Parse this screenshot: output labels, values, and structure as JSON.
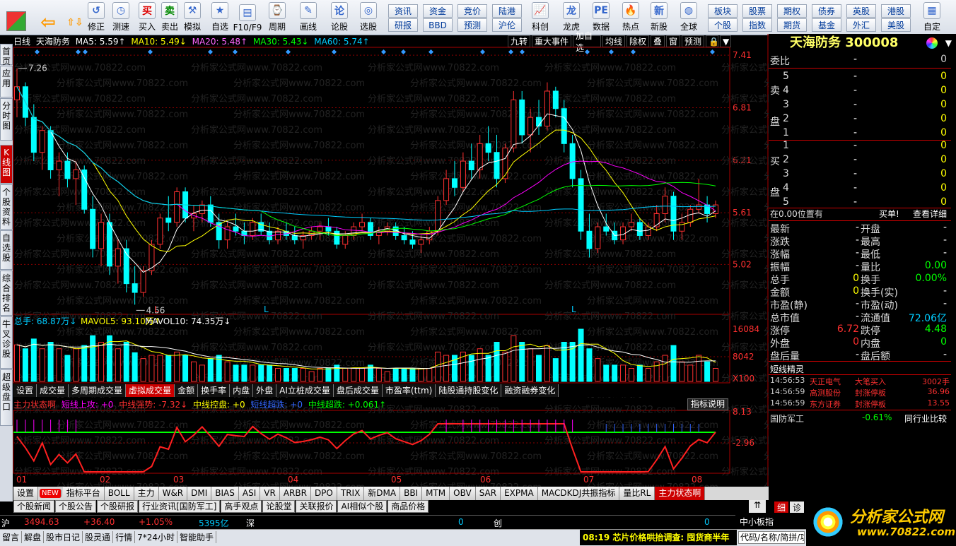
{
  "toolbar": {
    "buttons": [
      {
        "label": "后退",
        "icon": "back-arrow-icon"
      },
      {
        "label": "修正",
        "icon": "fix-icon"
      },
      {
        "label": "测速",
        "icon": "clock-icon"
      },
      {
        "label": "买入",
        "icon": "buy-icon",
        "glyph": "买"
      },
      {
        "label": "卖出",
        "icon": "sell-icon",
        "glyph": "卖"
      },
      {
        "label": "模拟",
        "icon": "hammer-icon"
      },
      {
        "label": "自选",
        "icon": "star-icon"
      },
      {
        "label": "F10/F9",
        "icon": "f10-icon"
      },
      {
        "label": "周期",
        "icon": "period-icon"
      },
      {
        "label": "画线",
        "icon": "pencil-icon"
      },
      {
        "label": "论股",
        "icon": "forum-icon"
      },
      {
        "label": "选股",
        "icon": "select-stock-icon"
      },
      {
        "label": "科创",
        "icon": "kechuang-icon"
      },
      {
        "label": "龙虎",
        "icon": "dragon-tiger-icon"
      },
      {
        "label": "数据",
        "icon": "data-icon"
      },
      {
        "label": "热点",
        "icon": "hot-icon"
      },
      {
        "label": "新股",
        "icon": "ipo-icon"
      },
      {
        "label": "全球",
        "icon": "globe-icon"
      },
      {
        "label": "自定",
        "icon": "custom-icon"
      }
    ],
    "grid_buttons": [
      "资讯",
      "资金",
      "竞价",
      "陆港",
      "研报",
      "BBD",
      "预测",
      "沪伦",
      "板块",
      "股票",
      "期权",
      "债券",
      "英股",
      "港股",
      "个股",
      "指数",
      "期货",
      "基金",
      "外汇",
      "美股"
    ]
  },
  "side_tabs": [
    "首页",
    "应用",
    "分时图",
    "K线图",
    "个股资料",
    "自选股",
    "综合排名",
    "牛叉诊股",
    "超级盘口"
  ],
  "chart_header": {
    "period": "日线",
    "stock": "天海防务",
    "ma5": "MA5: 5.59↑",
    "ma10": "MA10: 5.49↓",
    "ma20": "MA20: 5.48↑",
    "ma30": "MA30: 5.43↓",
    "ma60": "MA60: 5.74↑"
  },
  "chart_buttons": [
    "九转",
    "重大事件",
    "加自选",
    "均线",
    "除权",
    "叠",
    "窗",
    "预测"
  ],
  "price_axis": [
    "7.41",
    "6.81",
    "6.21",
    "5.61",
    "5.02"
  ],
  "annotations": {
    "high": "7.26",
    "low": "4.56",
    "markers": [
      "L",
      "L",
      "L"
    ]
  },
  "volume_header": {
    "total": "总手: 68.87万↓",
    "mavol5": "MAVOL5: 93.10万↑",
    "mavol10": "MAVOL10: 74.35万↓"
  },
  "volume_axis": [
    "16084",
    "8042",
    "X100"
  ],
  "mid_tabs": [
    "设置",
    "成交量",
    "多周期成交量",
    "虚拟成交量",
    "金额",
    "换手率",
    "内盘",
    "外盘",
    "AI立桩成交量",
    "盘后成交量",
    "市盈率(ttm)",
    "陆股通持股变化",
    "融资融券变化"
  ],
  "indicator_header": {
    "name": "主力状态啊",
    "t1": "短线上攻: +0",
    "t2": "中线强势: -7.32↓",
    "t3": "中线控盘: +0",
    "t4": "短线超跌: +0",
    "t5": "中线超跌: +0.061↑",
    "btn": "指标说明"
  },
  "indicator_axis": [
    "8.13",
    "-2.96"
  ],
  "x_axis": [
    "01",
    "02",
    "03",
    "04",
    "05",
    "06",
    "07",
    "08"
  ],
  "bottom_tabs": [
    "设置",
    "NEW",
    "指标平台",
    "BOLL",
    "主力",
    "W&R",
    "DMI",
    "BIAS",
    "ASI",
    "VR",
    "ARBR",
    "DPO",
    "TRIX",
    "新DMA",
    "BBI",
    "MTM",
    "OBV",
    "SAR",
    "EXPMA",
    "MACDKDJ共振指标",
    "量比RL",
    "主力状态啊"
  ],
  "sub_tabs": [
    "个股新闻",
    "个股公告",
    "个股研报",
    "行业资讯[国防军工]",
    "高手观点",
    "论股堂",
    "关联报价",
    "AI相似个股",
    "商品价格"
  ],
  "right": {
    "title": "天海防务 300008",
    "weibi": "委比",
    "weibi_v1": "-",
    "weibi_v2": "0",
    "sell_label": "卖盘",
    "buy_label": "买盘",
    "sells": [
      {
        "n": "5",
        "p": "-",
        "v": "0"
      },
      {
        "n": "4",
        "p": "-",
        "v": "0"
      },
      {
        "n": "3",
        "p": "-",
        "v": "0"
      },
      {
        "n": "2",
        "p": "-",
        "v": "0"
      },
      {
        "n": "1",
        "p": "-",
        "v": "0"
      }
    ],
    "buys": [
      {
        "n": "1",
        "p": "-",
        "v": "0"
      },
      {
        "n": "2",
        "p": "-",
        "v": "0"
      },
      {
        "n": "3",
        "p": "-",
        "v": "0"
      },
      {
        "n": "4",
        "p": "-",
        "v": "0"
      },
      {
        "n": "5",
        "p": "-",
        "v": "0"
      }
    ],
    "position": "在0.00位置有",
    "buy_single": "买单!",
    "detail": "查看详细",
    "stats": [
      [
        "最新",
        "-",
        "开盘",
        "-"
      ],
      [
        "涨跌",
        "-",
        "最高",
        "-"
      ],
      [
        "涨幅",
        "-",
        "最低",
        "-"
      ],
      [
        "振幅",
        "-",
        "量比",
        "0.00"
      ],
      [
        "总手",
        "0",
        "换手",
        "0.00%"
      ],
      [
        "金额",
        "0",
        "换手(实)",
        "-"
      ],
      [
        "市盈(静)",
        "-",
        "市盈(动)",
        "-"
      ],
      [
        "总市值",
        "-",
        "流通值",
        "72.06亿"
      ],
      [
        "涨停",
        "6.72",
        "跌停",
        "4.48"
      ],
      [
        "外盘",
        "0",
        "内盘",
        "0"
      ],
      [
        "盘后量",
        "-",
        "盘后额",
        "-"
      ]
    ],
    "elves_title": "短线精灵",
    "elves": [
      [
        "14:56:53",
        "天正电气",
        "大笔买入",
        "3002手"
      ],
      [
        "14:56:59",
        "高测股份",
        "封涨停板",
        "36.96"
      ],
      [
        "14:56:59",
        "东方证券",
        "封涨停板",
        "13.55"
      ]
    ],
    "industry": "国防军工",
    "industry_pct": "-0.61%",
    "industry_btn": "同行业比较",
    "fine": "细",
    "diag": "诊",
    "logo": "分析家公式网",
    "logo_url": "www.70822.com"
  },
  "status": {
    "sh": "沪",
    "sh_val": "3494.63",
    "sh_chg": "+36.40",
    "sh_pct": "+1.05%",
    "sh_amt": "5395亿",
    "sz": "深",
    "sz_val": "0",
    "cy": "创",
    "cy_val": "0",
    "zxb": "中小板指",
    "items": [
      "留言",
      "解盘",
      "股市日记",
      "股灵通",
      "行情",
      "7*24小时",
      "智能助手"
    ],
    "news": "08:19 芯片价格哄抬调查: 囤货商半年",
    "search": "代码/名称/简拼/功能"
  },
  "watermark": "分析家公式网www.70822.com",
  "chart_data": {
    "type": "candlestick",
    "price_range": [
      4.56,
      7.41
    ],
    "high_label": 7.26,
    "low_label": 4.56,
    "x_months": [
      "01",
      "02",
      "03",
      "04",
      "05",
      "06",
      "07",
      "08"
    ],
    "ohlc": [
      [
        6.9,
        7.26,
        6.7,
        7.05
      ],
      [
        7.05,
        7.1,
        6.6,
        6.7
      ],
      [
        6.7,
        6.85,
        6.2,
        6.3
      ],
      [
        6.3,
        6.6,
        6.1,
        6.55
      ],
      [
        6.55,
        6.6,
        6.0,
        6.1
      ],
      [
        6.1,
        6.3,
        5.8,
        6.2
      ],
      [
        6.2,
        6.3,
        5.9,
        6.0
      ],
      [
        6.0,
        6.2,
        5.7,
        6.1
      ],
      [
        6.1,
        6.15,
        5.6,
        5.65
      ],
      [
        5.65,
        5.8,
        5.1,
        5.2
      ],
      [
        5.2,
        5.6,
        5.0,
        5.5
      ],
      [
        5.5,
        5.6,
        4.9,
        5.0
      ],
      [
        5.0,
        5.3,
        4.8,
        5.2
      ],
      [
        5.2,
        5.3,
        4.7,
        4.8
      ],
      [
        4.8,
        5.0,
        4.56,
        4.7
      ],
      [
        4.7,
        5.0,
        4.65,
        4.95
      ],
      [
        4.95,
        5.3,
        4.9,
        5.25
      ],
      [
        5.25,
        5.6,
        5.2,
        5.55
      ],
      [
        5.55,
        5.8,
        5.4,
        5.5
      ],
      [
        5.5,
        5.9,
        5.45,
        5.85
      ],
      [
        5.85,
        5.9,
        5.5,
        5.55
      ],
      [
        5.55,
        5.7,
        5.4,
        5.6
      ],
      [
        5.6,
        5.75,
        5.5,
        5.7
      ],
      [
        5.7,
        5.8,
        5.45,
        5.5
      ],
      [
        5.5,
        5.6,
        5.2,
        5.3
      ],
      [
        5.3,
        5.5,
        5.2,
        5.45
      ],
      [
        5.45,
        5.6,
        5.35,
        5.4
      ],
      [
        5.4,
        5.5,
        5.25,
        5.35
      ],
      [
        5.35,
        5.55,
        5.3,
        5.5
      ],
      [
        5.5,
        5.6,
        5.35,
        5.4
      ],
      [
        5.4,
        5.5,
        5.25,
        5.3
      ],
      [
        5.3,
        5.45,
        5.25,
        5.4
      ],
      [
        5.4,
        5.5,
        5.3,
        5.35
      ],
      [
        5.35,
        5.45,
        5.25,
        5.3
      ],
      [
        5.3,
        5.4,
        5.2,
        5.35
      ],
      [
        5.35,
        5.45,
        5.3,
        5.4
      ],
      [
        5.4,
        5.5,
        5.3,
        5.45
      ],
      [
        5.45,
        5.55,
        5.35,
        5.4
      ],
      [
        5.4,
        5.45,
        5.2,
        5.25
      ],
      [
        5.25,
        5.4,
        5.2,
        5.35
      ],
      [
        5.35,
        5.5,
        5.3,
        5.45
      ],
      [
        5.45,
        5.6,
        5.4,
        5.5
      ],
      [
        5.5,
        5.55,
        5.3,
        5.35
      ],
      [
        5.35,
        5.45,
        5.25,
        5.4
      ],
      [
        5.4,
        5.5,
        5.35,
        5.45
      ],
      [
        5.45,
        5.5,
        5.3,
        5.35
      ],
      [
        5.35,
        5.45,
        5.25,
        5.3
      ],
      [
        5.3,
        5.4,
        5.2,
        5.25
      ],
      [
        5.25,
        5.35,
        5.15,
        5.3
      ],
      [
        5.3,
        5.45,
        5.25,
        5.4
      ],
      [
        5.4,
        5.8,
        5.35,
        5.75
      ],
      [
        5.75,
        6.1,
        5.7,
        6.0
      ],
      [
        6.0,
        6.2,
        5.8,
        5.9
      ],
      [
        5.9,
        6.3,
        5.85,
        6.2
      ],
      [
        6.2,
        6.4,
        6.0,
        6.1
      ],
      [
        6.1,
        6.5,
        6.0,
        6.4
      ],
      [
        6.4,
        6.6,
        6.2,
        6.3
      ],
      [
        6.3,
        6.5,
        5.9,
        6.0
      ],
      [
        6.0,
        6.4,
        5.95,
        6.35
      ],
      [
        6.35,
        7.0,
        6.3,
        6.9
      ],
      [
        6.9,
        7.0,
        6.4,
        6.5
      ],
      [
        6.5,
        6.8,
        6.3,
        6.7
      ],
      [
        6.7,
        6.9,
        6.5,
        6.6
      ],
      [
        6.6,
        7.1,
        6.55,
        7.0
      ],
      [
        7.0,
        7.05,
        6.7,
        6.8
      ],
      [
        6.8,
        6.9,
        6.3,
        6.4
      ],
      [
        6.4,
        6.5,
        5.9,
        6.0
      ],
      [
        6.0,
        6.1,
        5.3,
        5.4
      ],
      [
        5.4,
        5.6,
        5.1,
        5.2
      ],
      [
        5.2,
        5.5,
        5.15,
        5.45
      ],
      [
        5.45,
        5.6,
        5.35,
        5.4
      ],
      [
        5.4,
        5.5,
        5.25,
        5.3
      ],
      [
        5.3,
        5.5,
        5.25,
        5.45
      ],
      [
        5.45,
        5.6,
        5.4,
        5.5
      ],
      [
        5.5,
        5.55,
        5.3,
        5.35
      ],
      [
        5.35,
        5.5,
        5.3,
        5.45
      ],
      [
        5.45,
        5.7,
        5.4,
        5.6
      ],
      [
        5.6,
        5.9,
        5.5,
        5.8
      ],
      [
        5.8,
        5.85,
        5.3,
        5.4
      ],
      [
        5.4,
        5.6,
        5.3,
        5.5
      ],
      [
        5.5,
        5.7,
        5.45,
        5.65
      ],
      [
        5.65,
        6.0,
        5.6,
        5.7
      ],
      [
        5.7,
        5.8,
        5.5,
        5.6
      ],
      [
        5.6,
        5.75,
        5.55,
        5.7
      ]
    ],
    "ma_colors": {
      "ma5": "#ffffff",
      "ma10": "#ffff00",
      "ma20": "#ff00ff",
      "ma30": "#00ff00",
      "ma60": "#00ccff"
    }
  }
}
